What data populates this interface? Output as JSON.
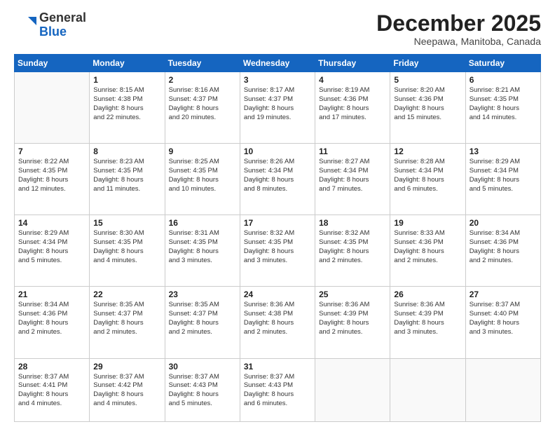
{
  "header": {
    "logo": {
      "general": "General",
      "blue": "Blue"
    },
    "title": "December 2025",
    "location": "Neepawa, Manitoba, Canada"
  },
  "calendar": {
    "days_of_week": [
      "Sunday",
      "Monday",
      "Tuesday",
      "Wednesday",
      "Thursday",
      "Friday",
      "Saturday"
    ],
    "weeks": [
      [
        {
          "day": "",
          "info": ""
        },
        {
          "day": "1",
          "info": "Sunrise: 8:15 AM\nSunset: 4:38 PM\nDaylight: 8 hours\nand 22 minutes."
        },
        {
          "day": "2",
          "info": "Sunrise: 8:16 AM\nSunset: 4:37 PM\nDaylight: 8 hours\nand 20 minutes."
        },
        {
          "day": "3",
          "info": "Sunrise: 8:17 AM\nSunset: 4:37 PM\nDaylight: 8 hours\nand 19 minutes."
        },
        {
          "day": "4",
          "info": "Sunrise: 8:19 AM\nSunset: 4:36 PM\nDaylight: 8 hours\nand 17 minutes."
        },
        {
          "day": "5",
          "info": "Sunrise: 8:20 AM\nSunset: 4:36 PM\nDaylight: 8 hours\nand 15 minutes."
        },
        {
          "day": "6",
          "info": "Sunrise: 8:21 AM\nSunset: 4:35 PM\nDaylight: 8 hours\nand 14 minutes."
        }
      ],
      [
        {
          "day": "7",
          "info": "Sunrise: 8:22 AM\nSunset: 4:35 PM\nDaylight: 8 hours\nand 12 minutes."
        },
        {
          "day": "8",
          "info": "Sunrise: 8:23 AM\nSunset: 4:35 PM\nDaylight: 8 hours\nand 11 minutes."
        },
        {
          "day": "9",
          "info": "Sunrise: 8:25 AM\nSunset: 4:35 PM\nDaylight: 8 hours\nand 10 minutes."
        },
        {
          "day": "10",
          "info": "Sunrise: 8:26 AM\nSunset: 4:34 PM\nDaylight: 8 hours\nand 8 minutes."
        },
        {
          "day": "11",
          "info": "Sunrise: 8:27 AM\nSunset: 4:34 PM\nDaylight: 8 hours\nand 7 minutes."
        },
        {
          "day": "12",
          "info": "Sunrise: 8:28 AM\nSunset: 4:34 PM\nDaylight: 8 hours\nand 6 minutes."
        },
        {
          "day": "13",
          "info": "Sunrise: 8:29 AM\nSunset: 4:34 PM\nDaylight: 8 hours\nand 5 minutes."
        }
      ],
      [
        {
          "day": "14",
          "info": "Sunrise: 8:29 AM\nSunset: 4:34 PM\nDaylight: 8 hours\nand 5 minutes."
        },
        {
          "day": "15",
          "info": "Sunrise: 8:30 AM\nSunset: 4:35 PM\nDaylight: 8 hours\nand 4 minutes."
        },
        {
          "day": "16",
          "info": "Sunrise: 8:31 AM\nSunset: 4:35 PM\nDaylight: 8 hours\nand 3 minutes."
        },
        {
          "day": "17",
          "info": "Sunrise: 8:32 AM\nSunset: 4:35 PM\nDaylight: 8 hours\nand 3 minutes."
        },
        {
          "day": "18",
          "info": "Sunrise: 8:32 AM\nSunset: 4:35 PM\nDaylight: 8 hours\nand 2 minutes."
        },
        {
          "day": "19",
          "info": "Sunrise: 8:33 AM\nSunset: 4:36 PM\nDaylight: 8 hours\nand 2 minutes."
        },
        {
          "day": "20",
          "info": "Sunrise: 8:34 AM\nSunset: 4:36 PM\nDaylight: 8 hours\nand 2 minutes."
        }
      ],
      [
        {
          "day": "21",
          "info": "Sunrise: 8:34 AM\nSunset: 4:36 PM\nDaylight: 8 hours\nand 2 minutes."
        },
        {
          "day": "22",
          "info": "Sunrise: 8:35 AM\nSunset: 4:37 PM\nDaylight: 8 hours\nand 2 minutes."
        },
        {
          "day": "23",
          "info": "Sunrise: 8:35 AM\nSunset: 4:37 PM\nDaylight: 8 hours\nand 2 minutes."
        },
        {
          "day": "24",
          "info": "Sunrise: 8:36 AM\nSunset: 4:38 PM\nDaylight: 8 hours\nand 2 minutes."
        },
        {
          "day": "25",
          "info": "Sunrise: 8:36 AM\nSunset: 4:39 PM\nDaylight: 8 hours\nand 2 minutes."
        },
        {
          "day": "26",
          "info": "Sunrise: 8:36 AM\nSunset: 4:39 PM\nDaylight: 8 hours\nand 3 minutes."
        },
        {
          "day": "27",
          "info": "Sunrise: 8:37 AM\nSunset: 4:40 PM\nDaylight: 8 hours\nand 3 minutes."
        }
      ],
      [
        {
          "day": "28",
          "info": "Sunrise: 8:37 AM\nSunset: 4:41 PM\nDaylight: 8 hours\nand 4 minutes."
        },
        {
          "day": "29",
          "info": "Sunrise: 8:37 AM\nSunset: 4:42 PM\nDaylight: 8 hours\nand 4 minutes."
        },
        {
          "day": "30",
          "info": "Sunrise: 8:37 AM\nSunset: 4:43 PM\nDaylight: 8 hours\nand 5 minutes."
        },
        {
          "day": "31",
          "info": "Sunrise: 8:37 AM\nSunset: 4:43 PM\nDaylight: 8 hours\nand 6 minutes."
        },
        {
          "day": "",
          "info": ""
        },
        {
          "day": "",
          "info": ""
        },
        {
          "day": "",
          "info": ""
        }
      ]
    ]
  }
}
